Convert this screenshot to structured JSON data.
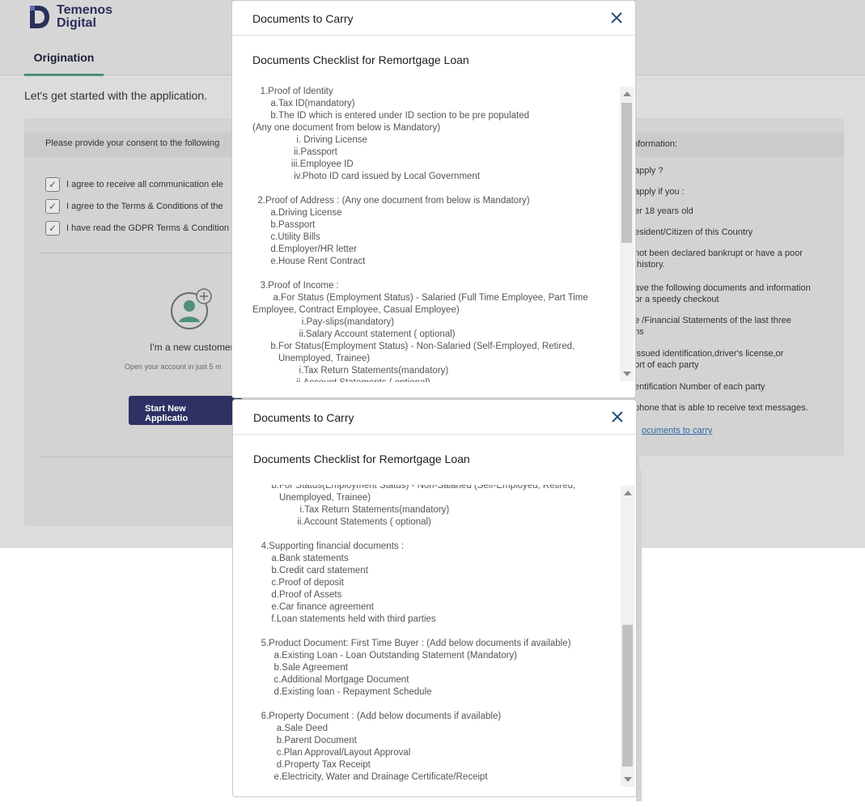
{
  "brand": {
    "line1": "Temenos",
    "line2": "Digital"
  },
  "nav": {
    "active_tab": "Origination"
  },
  "intro_text": "Let's get started with the application.",
  "consent": {
    "heading": "Please provide your consent to the following",
    "items": [
      {
        "label": "I agree to receive all communication ele",
        "checked": true
      },
      {
        "label": "I agree to the Terms & Conditions of the",
        "checked": true
      },
      {
        "label": "I have read the GDPR Terms & Condition",
        "checked": true
      }
    ]
  },
  "new_customer": {
    "title": "I'm a new customer",
    "note": "Open your account in just 5 m",
    "button": "Start New Applicatio"
  },
  "info_panel": {
    "heading": "nformation:",
    "lines": [
      "apply ?",
      "apply if you :",
      "er 18 years old",
      "esident/Citizen of this Country",
      "not been declared bankrupt or have a poor\n history.",
      "ave the following documents and information\nor a speedy checkout",
      "e /Financial Statements of the last three\nns",
      "issued identification,driver's license,or\nort of each party",
      "entification Number of each party",
      "phone that is able to receive text messages."
    ],
    "link": "ocuments to carry"
  },
  "modal_top": {
    "title": "Documents to Carry",
    "subtitle": "Documents Checklist for Remortgage Loan",
    "content": "   1.Proof of Identity\n       a.Tax ID(mandatory)\n       b.The ID which is entered under ID section to be pre populated\n(Any one document from below is Mandatory)\n                 i. Driving License\n                ii.Passport\n               iii.Employee ID\n                iv.Photo ID card issued by Local Government\n\n  2.Proof of Address : (Any one document from below is Mandatory)\n       a.Driving License\n       b.Passport\n       c.Utility Bills\n       d.Employer/HR letter\n       e.House Rent Contract\n\n   3.Proof of Income :\n        a.For Status (Employment Status) - Salaried (Full Time Employee, Part Time\nEmployee, Contract Employee, Casual Employee)\n                   i.Pay-slips(mandatory)\n                  ii.Salary Account statement ( optional)\n       b.For Status(Employment Status) - Non-Salaried (Self-Employed, Retired,\n          Unemployed, Trainee)\n                  i.Tax Return Statements(mandatory)\n                 ii.Account Statements ( optional)"
  },
  "modal_bottom": {
    "title": "Documents to Carry",
    "subtitle": "Documents Checklist for Remortgage Loan",
    "content": "       b.For Status(Employment Status) - Non-Salaried (Self-Employed, Retired,\n          Unemployed, Trainee)\n                  i.Tax Return Statements(mandatory)\n                 ii.Account Statements ( optional)\n\n   4.Supporting financial documents :\n       a.Bank statements\n       b.Credit card statement\n       c.Proof of deposit\n       d.Proof of Assets\n       e.Car finance agreement\n       f.Loan statements held with third parties\n\n   5.Product Document: First Time Buyer : (Add below documents if available)\n        a.Existing Loan - Loan Outstanding Statement (Mandatory)\n        b.Sale Agreement\n        c.Additional Mortgage Document\n        d.Existing loan - Repayment Schedule\n\n   6.Property Document : (Add below documents if available)\n         a.Sale Deed\n         b.Parent Document\n         c.Plan Approval/Layout Approval\n         d.Property Tax Receipt\n        e.Electricity, Water and Drainage Certificate/Receipt"
  },
  "scroll": {
    "top_position": 0.0,
    "bottom_position": 1.0
  },
  "colors": {
    "brand": "#2b2f5a",
    "accent": "#4f8f7e",
    "link": "#2e6aa8",
    "close": "#1f4e79"
  }
}
